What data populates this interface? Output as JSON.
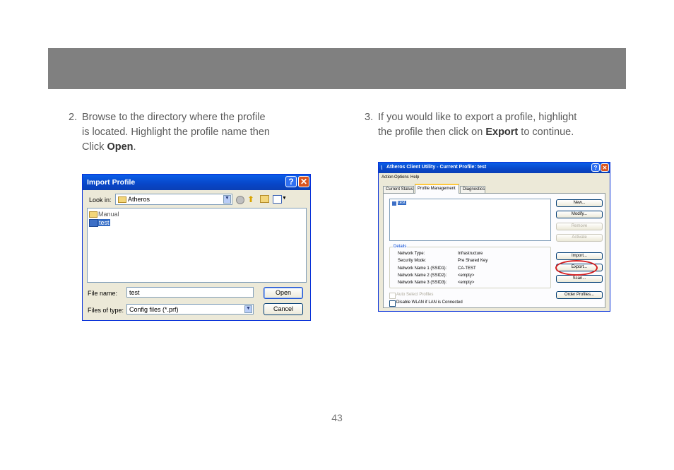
{
  "page_number": "43",
  "step2": {
    "num": "2.",
    "text1": "Browse to the directory where the profile",
    "text2": "is located.  Highlight the profile name then",
    "text3a": "Click ",
    "text3b": "Open",
    "text3c": "."
  },
  "step3": {
    "num": "3.",
    "text1": "If you would like to export a profile, highlight",
    "text2a": "the profile then click on ",
    "text2b": "Export",
    "text2c": " to continue."
  },
  "import_dialog": {
    "title": "Import Profile",
    "help_btn": "?",
    "close_btn": "✕",
    "look_in_label": "Look in:",
    "look_in_value": "Atheros",
    "files": [
      {
        "name": "Manual",
        "icon": "folder-icon",
        "selected": false
      },
      {
        "name": "test",
        "icon": "profile-file-icon",
        "selected": true
      }
    ],
    "file_name_label": "File name:",
    "file_name_value": "test",
    "file_type_label": "Files of type:",
    "file_type_value": "Config files (*.prf)",
    "open_label": "Open",
    "cancel_label": "Cancel"
  },
  "acu_window": {
    "title": "Atheros Client Utility - Current Profile: test",
    "help_btn": "?",
    "close_btn": "✕",
    "menu": [
      "Action",
      "Options",
      "Help"
    ],
    "tabs": [
      "Current Status",
      "Profile Management",
      "Diagnostics"
    ],
    "active_tab": "Profile Management",
    "profiles": [
      "test"
    ],
    "buttons": {
      "new": "New...",
      "modify": "Modify...",
      "remove": "Remove",
      "activate": "Activate",
      "import": "Import...",
      "export": "Export...",
      "scan": "Scan...",
      "order": "Order Profiles..."
    },
    "details_label": "Details",
    "details": [
      {
        "key": "Network Type:",
        "value": "Infrastructure"
      },
      {
        "key": "Security Mode:",
        "value": "Pre Shared Key"
      },
      {
        "key": "Network Name 1 (SSID1):",
        "value": "CA-TEST"
      },
      {
        "key": "Network Name 2 (SSID2):",
        "value": "<empty>"
      },
      {
        "key": "Network Name 3 (SSID3):",
        "value": "<empty>"
      }
    ],
    "auto_select": "Auto Select Profiles",
    "disable_wlan": "Disable WLAN if LAN is Connected",
    "highlight_color": "#d62020"
  }
}
